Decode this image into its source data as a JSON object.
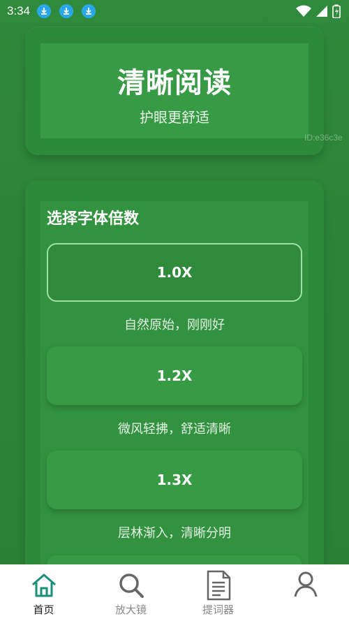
{
  "status_bar": {
    "time": "3:34"
  },
  "header": {
    "title": "清晰阅读",
    "subtitle": "护眼更舒适",
    "watermark": "ID:e36c3e"
  },
  "font_scale": {
    "heading": "选择字体倍数",
    "options": [
      {
        "label": "1.0X",
        "description": "自然原始，刚刚好",
        "selected": true
      },
      {
        "label": "1.2X",
        "description": "微风轻拂，舒适清晰",
        "selected": false
      },
      {
        "label": "1.3X",
        "description": "层林渐入，清晰分明",
        "selected": false
      }
    ]
  },
  "bottom_nav": {
    "items": [
      {
        "label": "首页",
        "icon": "home-icon",
        "active": true
      },
      {
        "label": "放大镜",
        "icon": "magnifier-icon",
        "active": false
      },
      {
        "label": "提词器",
        "icon": "document-icon",
        "active": false
      },
      {
        "label": "",
        "icon": "profile-icon",
        "active": false
      }
    ]
  },
  "colors": {
    "background": "#2e8a3b",
    "accent_border": "#9fe0a5",
    "nav_active": "#1a8f7a",
    "download_badge": "#2aa7e8"
  }
}
